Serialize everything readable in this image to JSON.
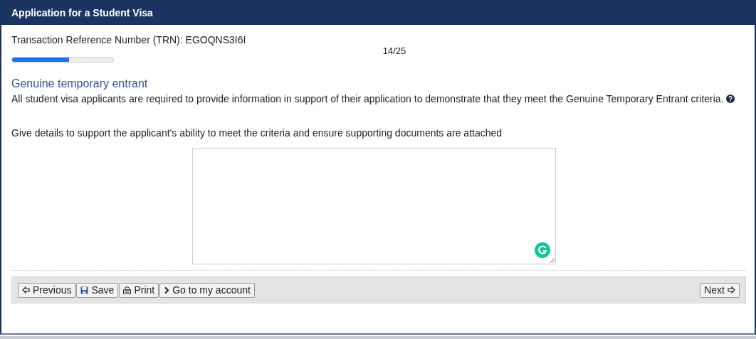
{
  "window": {
    "title": "Application for a Student Visa"
  },
  "trn": "Transaction Reference Number (TRN): EGOQNS3I6I",
  "progress": {
    "label": "14/25",
    "level": 0.56
  },
  "section": {
    "heading": "Genuine temporary entrant",
    "description": "All student visa applicants are required to provide information in support of their application to demonstrate that they meet the Genuine Temporary Entrant criteria.",
    "question": "Give details to support the applicant's ability to meet the criteria and ensure supporting documents are attached"
  },
  "toolbar_left": [
    {
      "label": "Previous",
      "kind": "previous"
    },
    {
      "label": "Save",
      "kind": "save"
    },
    {
      "label": "Print",
      "kind": "print"
    },
    {
      "label": "Go to my account",
      "kind": "account"
    }
  ],
  "toolbar_right": [
    {
      "label": "Next",
      "kind": "next"
    }
  ]
}
